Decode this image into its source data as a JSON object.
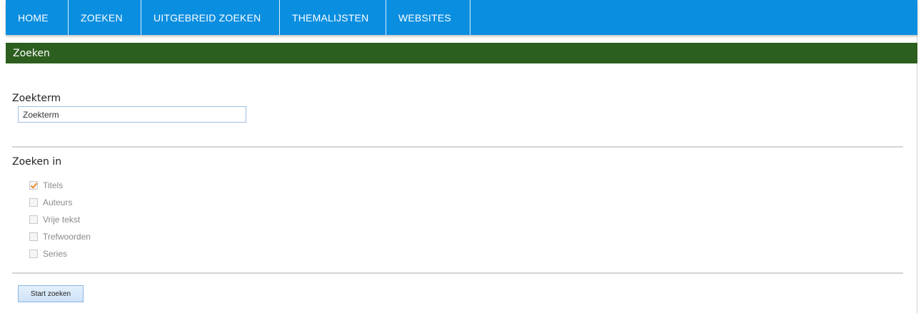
{
  "colors": {
    "nav_background": "#0a8ee0",
    "section_header_background": "#2c5e1f"
  },
  "nav": {
    "items": [
      {
        "label": "HOME"
      },
      {
        "label": "ZOEKEN"
      },
      {
        "label": "UITGEBREID ZOEKEN"
      },
      {
        "label": "THEMALIJSTEN"
      },
      {
        "label": "WEBSITES"
      }
    ]
  },
  "section": {
    "title": "Zoeken"
  },
  "search": {
    "label": "Zoekterm",
    "placeholder": "Zoekterm",
    "value": ""
  },
  "search_in": {
    "label": "Zoeken in",
    "options": [
      {
        "label": "Titels",
        "checked": true
      },
      {
        "label": "Auteurs",
        "checked": false
      },
      {
        "label": "Vrije tekst",
        "checked": false
      },
      {
        "label": "Trefwoorden",
        "checked": false
      },
      {
        "label": "Series",
        "checked": false
      }
    ]
  },
  "actions": {
    "start_label": "Start zoeken"
  }
}
